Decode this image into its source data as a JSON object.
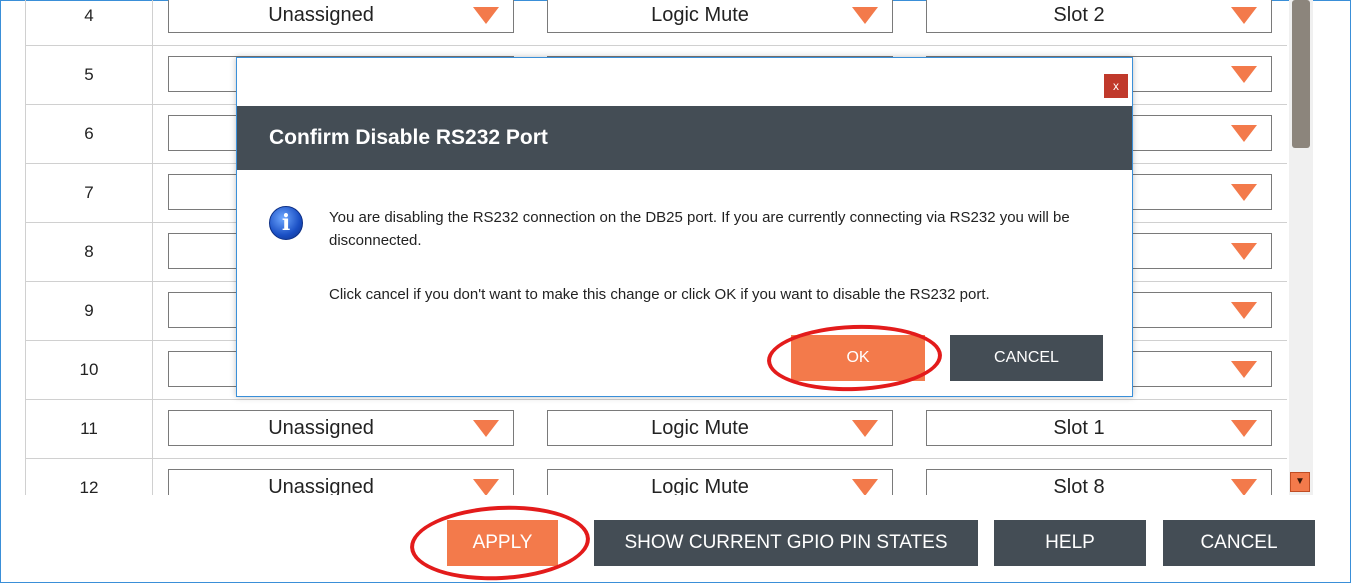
{
  "grid": {
    "rows": [
      {
        "num": "4",
        "col1": "Unassigned",
        "col2": "Logic Mute",
        "col3": "Slot 2"
      },
      {
        "num": "5",
        "col1": "",
        "col2": "",
        "col3": ""
      },
      {
        "num": "6",
        "col1": "",
        "col2": "",
        "col3": ""
      },
      {
        "num": "7",
        "col1": "",
        "col2": "",
        "col3": ""
      },
      {
        "num": "8",
        "col1": "",
        "col2": "",
        "col3": ""
      },
      {
        "num": "9",
        "col1": "",
        "col2": "",
        "col3": ""
      },
      {
        "num": "10",
        "col1": "",
        "col2": "",
        "col3": ""
      },
      {
        "num": "11",
        "col1": "Unassigned",
        "col2": "Logic Mute",
        "col3": "Slot 1"
      },
      {
        "num": "12",
        "col1": "Unassigned",
        "col2": "Logic Mute",
        "col3": "Slot 8"
      }
    ]
  },
  "footer": {
    "apply_label": "APPLY",
    "show_gpio_label": "SHOW CURRENT GPIO PIN STATES",
    "help_label": "HELP",
    "cancel_label": "CANCEL"
  },
  "dialog": {
    "close_glyph": "x",
    "title": "Confirm Disable RS232 Port",
    "icon": "info-icon",
    "message_1": "You are disabling the RS232 connection on the DB25 port. If you are currently connecting via RS232 you will be disconnected.",
    "message_2": "Click cancel if you don't want to make this change or click OK if you want to disable the RS232 port.",
    "ok_label": "OK",
    "cancel_label": "CANCEL"
  },
  "colors": {
    "accent": "#f37a4b",
    "dark_button": "#444d55",
    "highlight_ring": "#e31b1b",
    "close_button": "#c0392b"
  }
}
